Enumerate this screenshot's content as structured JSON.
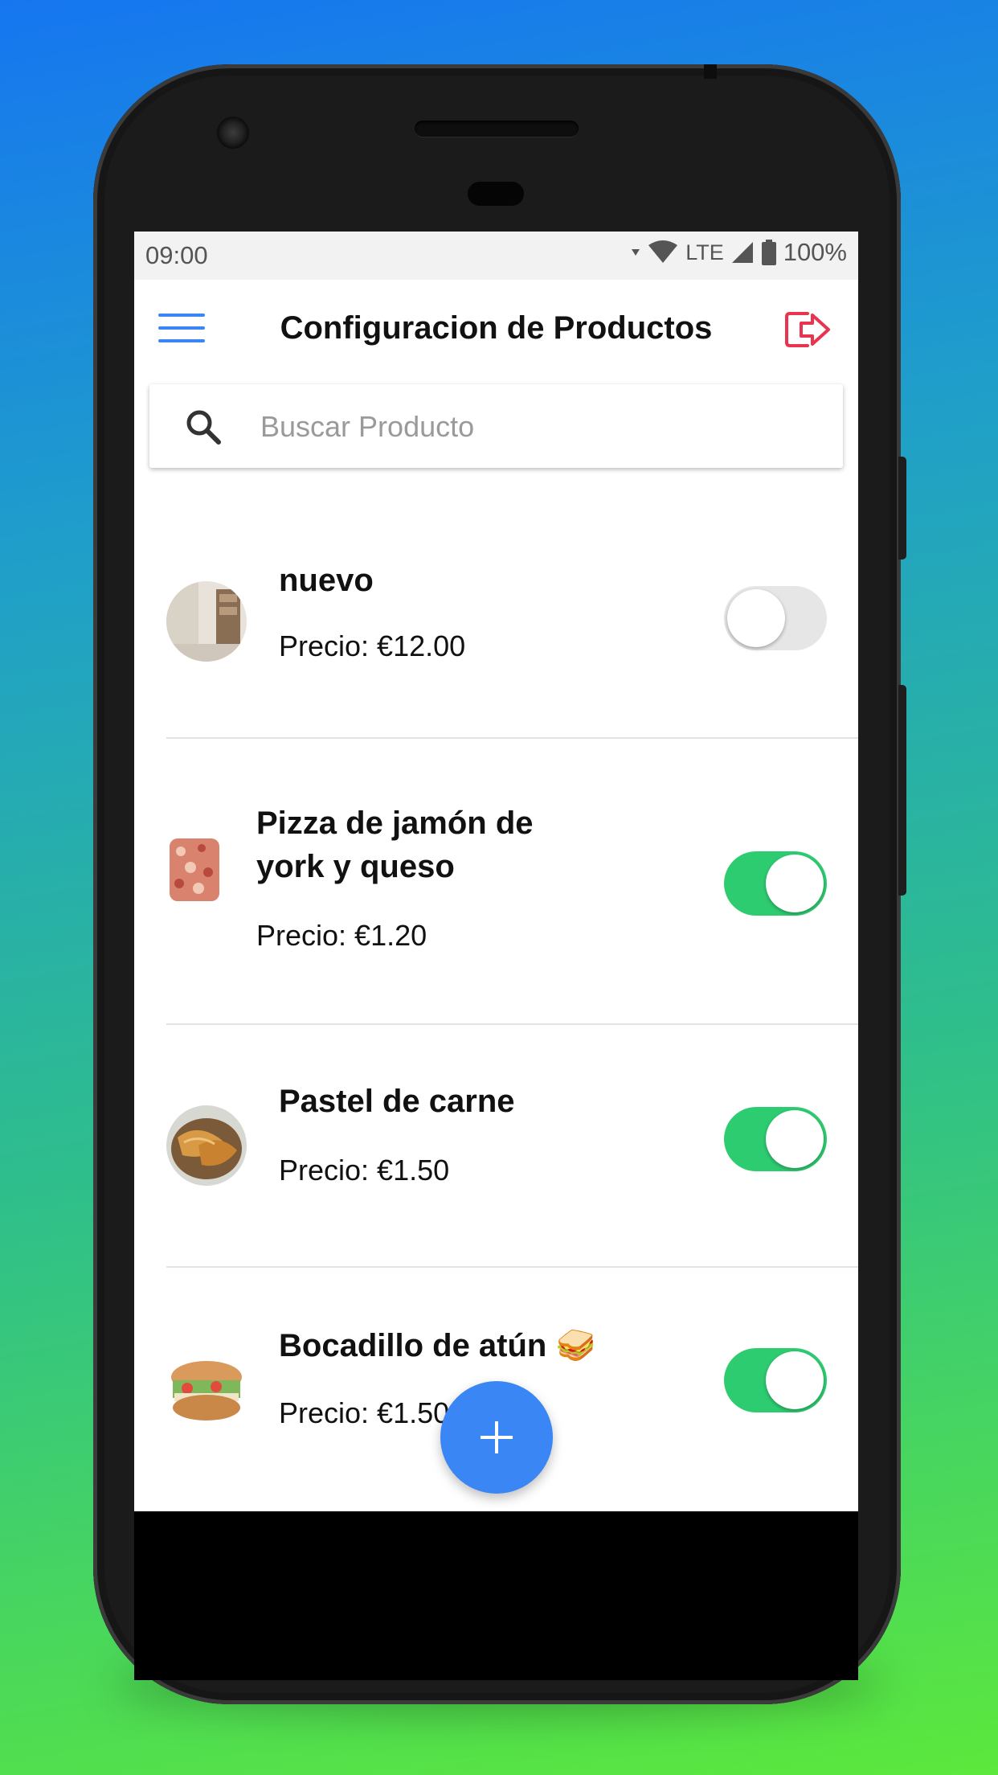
{
  "status_bar": {
    "time": "09:00",
    "network": "LTE",
    "battery": "100%"
  },
  "app_bar": {
    "title": "Configuracion de Productos",
    "menu_icon": "hamburger-menu-icon",
    "logout_icon": "logout-icon"
  },
  "search": {
    "placeholder": "Buscar Producto",
    "value": ""
  },
  "products": [
    {
      "name": "nuevo",
      "price": "Precio: €12.00",
      "enabled": false,
      "image": "room-photo"
    },
    {
      "name": "Pizza de jamón de york y queso",
      "price": "Precio: €1.20",
      "enabled": true,
      "image": "pizza-photo"
    },
    {
      "name": "Pastel de carne",
      "price": "Precio: €1.50",
      "enabled": true,
      "image": "meat-pie-photo"
    },
    {
      "name": "Bocadillo de atún",
      "emoji": "🥪",
      "price": "Precio: €1.50",
      "enabled": true,
      "image": "sandwich-photo"
    }
  ],
  "fab": {
    "icon": "plus-icon"
  },
  "colors": {
    "accent": "#3a86f5",
    "toggle_on": "#2ecc71",
    "logout": "#e8344e"
  }
}
